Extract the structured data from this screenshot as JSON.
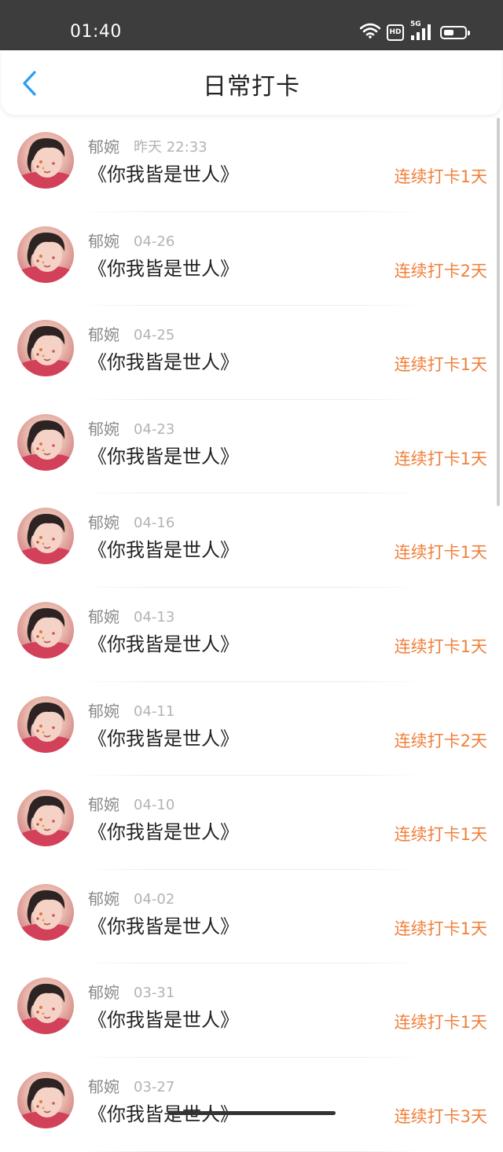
{
  "status_bar": {
    "time": "01:40",
    "hd_label": "HD",
    "network_label": "5G",
    "battery_level": 0.5,
    "icons": [
      "wifi-icon",
      "hd-icon",
      "signal-5g-icon",
      "battery-icon"
    ]
  },
  "header": {
    "title": "日常打卡",
    "back_icon": "chevron-left-icon"
  },
  "colors": {
    "accent_blue": "#2a9df4",
    "streak_orange": "#f0803c",
    "status_bar_bg": "#3d3d3d"
  },
  "entries": [
    {
      "name": "郁婉",
      "date": "昨天 22:33",
      "book": "《你我皆是世人》",
      "streak": "连续打卡1天"
    },
    {
      "name": "郁婉",
      "date": "04-26",
      "book": "《你我皆是世人》",
      "streak": "连续打卡2天"
    },
    {
      "name": "郁婉",
      "date": "04-25",
      "book": "《你我皆是世人》",
      "streak": "连续打卡1天"
    },
    {
      "name": "郁婉",
      "date": "04-23",
      "book": "《你我皆是世人》",
      "streak": "连续打卡1天"
    },
    {
      "name": "郁婉",
      "date": "04-16",
      "book": "《你我皆是世人》",
      "streak": "连续打卡1天"
    },
    {
      "name": "郁婉",
      "date": "04-13",
      "book": "《你我皆是世人》",
      "streak": "连续打卡1天"
    },
    {
      "name": "郁婉",
      "date": "04-11",
      "book": "《你我皆是世人》",
      "streak": "连续打卡2天"
    },
    {
      "name": "郁婉",
      "date": "04-10",
      "book": "《你我皆是世人》",
      "streak": "连续打卡1天"
    },
    {
      "name": "郁婉",
      "date": "04-02",
      "book": "《你我皆是世人》",
      "streak": "连续打卡1天"
    },
    {
      "name": "郁婉",
      "date": "03-31",
      "book": "《你我皆是世人》",
      "streak": "连续打卡1天"
    },
    {
      "name": "郁婉",
      "date": "03-27",
      "book": "《你我皆是世人》",
      "streak": "连续打卡3天"
    }
  ]
}
